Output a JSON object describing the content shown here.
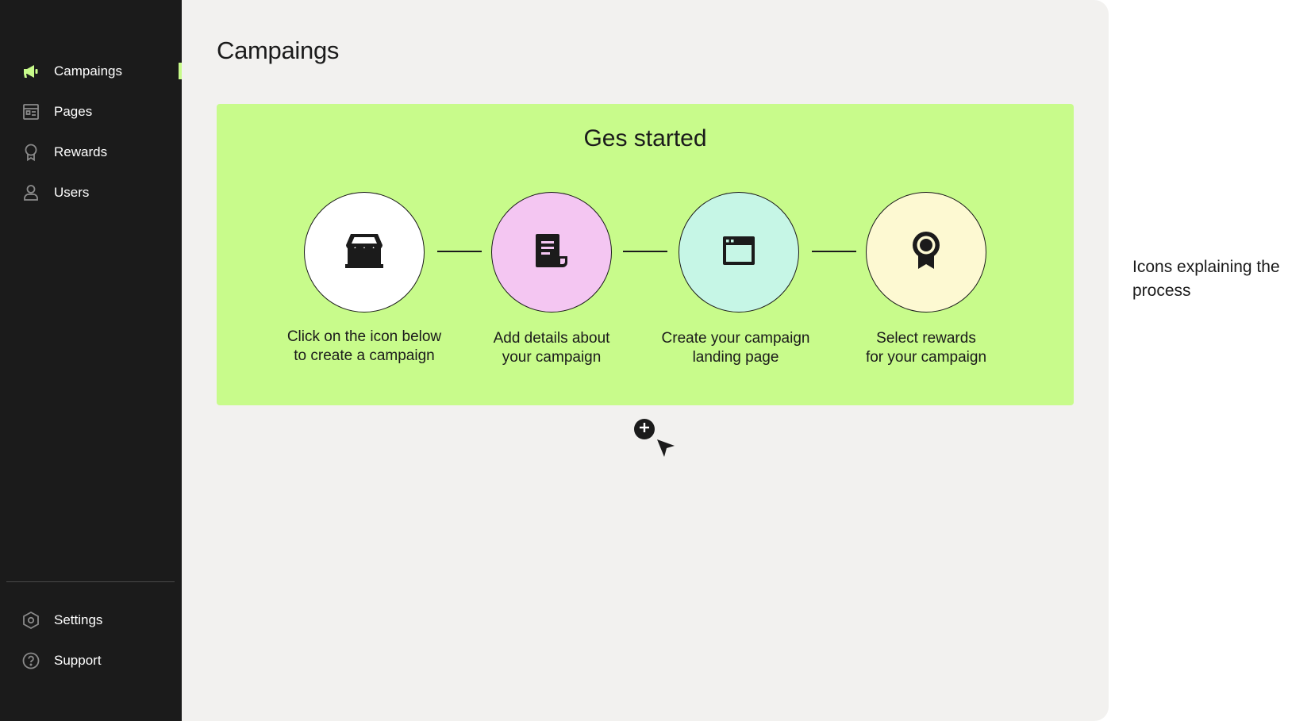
{
  "sidebar": {
    "items": [
      {
        "label": "Campaings",
        "icon": "megaphone-icon",
        "active": true
      },
      {
        "label": "Pages",
        "icon": "page-icon"
      },
      {
        "label": "Rewards",
        "icon": "award-icon"
      },
      {
        "label": "Users",
        "icon": "user-icon"
      }
    ],
    "bottom_items": [
      {
        "label": "Settings",
        "icon": "settings-icon"
      },
      {
        "label": "Support",
        "icon": "help-icon"
      }
    ]
  },
  "main": {
    "title": "Campaings",
    "panel": {
      "title": "Ges started",
      "steps": [
        {
          "icon": "storefront-icon",
          "label_line1": "Click on the icon below",
          "label_line2": "to create a campaign",
          "color": "#ffffff"
        },
        {
          "icon": "receipt-icon",
          "label_line1": "Add details about",
          "label_line2": "your campaign",
          "color": "#f4c6f2"
        },
        {
          "icon": "browser-window-icon",
          "label_line1": "Create your campaign",
          "label_line2": "landing page",
          "color": "#c6f6e6"
        },
        {
          "icon": "award-ribbon-icon",
          "label_line1": "Select rewards",
          "label_line2": "for your campaign",
          "color": "#fdf9d2"
        }
      ]
    }
  },
  "annotation": {
    "line1": "Icons explaining the",
    "line2": "process"
  },
  "colors": {
    "sidebar_bg": "#1b1b1b",
    "accent": "#c8fb8b",
    "main_bg": "#f2f1ef"
  }
}
